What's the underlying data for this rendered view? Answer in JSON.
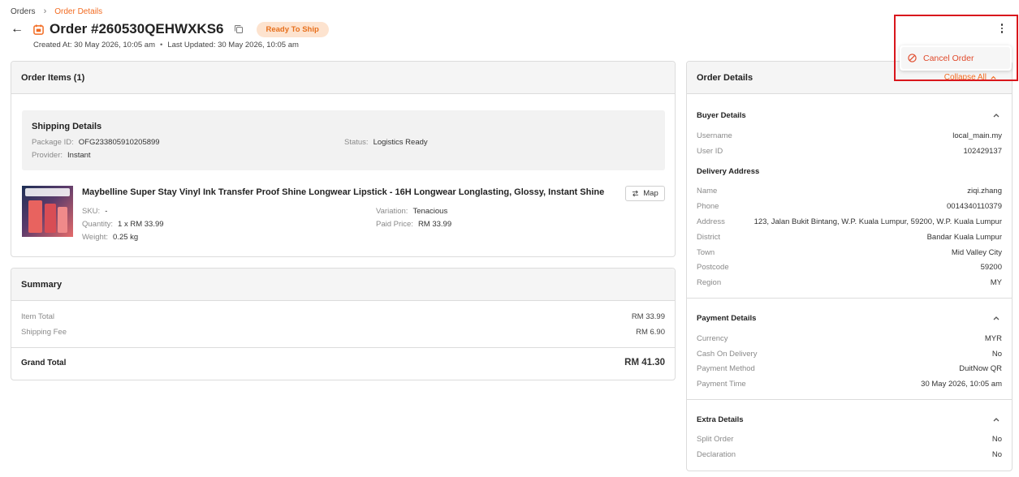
{
  "breadcrumb": {
    "root": "Orders",
    "current": "Order Details"
  },
  "header": {
    "title": "Order #260530QEHWXKS6",
    "status": "Ready To Ship",
    "created": "Created At: 30 May 2026, 10:05 am",
    "updated": "Last Updated: 30 May 2026, 10:05 am"
  },
  "menu": {
    "cancel_label": "Cancel Order"
  },
  "order_items": {
    "title": "Order Items (1)",
    "shipping": {
      "title": "Shipping Details",
      "package_id_label": "Package ID:",
      "package_id": "OFG233805910205899",
      "provider_label": "Provider:",
      "provider": "Instant",
      "status_label": "Status:",
      "status": "Logistics Ready"
    },
    "product": {
      "name": "Maybelline Super Stay Vinyl Ink Transfer Proof Shine Longwear Lipstick - 16H Longwear Longlasting, Glossy, Instant Shine",
      "map_label": "Map",
      "sku_label": "SKU:",
      "sku": "-",
      "quantity_label": "Quantity:",
      "quantity": "1 x RM 33.99",
      "weight_label": "Weight:",
      "weight": "0.25 kg",
      "variation_label": "Variation:",
      "variation": "Tenacious",
      "paid_price_label": "Paid Price:",
      "paid_price": "RM 33.99"
    }
  },
  "summary": {
    "title": "Summary",
    "item_total_label": "Item Total",
    "item_total": "RM 33.99",
    "shipping_fee_label": "Shipping Fee",
    "shipping_fee": "RM 6.90",
    "grand_total_label": "Grand Total",
    "grand_total": "RM 41.30"
  },
  "details": {
    "title": "Order Details",
    "collapse_all": "Collapse All",
    "buyer": {
      "title": "Buyer Details",
      "username_label": "Username",
      "username": "local_main.my",
      "user_id_label": "User ID",
      "user_id": "102429137"
    },
    "delivery": {
      "title": "Delivery Address",
      "name_label": "Name",
      "name": "ziqi.zhang",
      "phone_label": "Phone",
      "phone": "0014340110379",
      "address_label": "Address",
      "address": "123, Jalan Bukit Bintang, W.P. Kuala Lumpur, 59200, W.P. Kuala Lumpur",
      "district_label": "District",
      "district": "Bandar Kuala Lumpur",
      "town_label": "Town",
      "town": "Mid Valley City",
      "postcode_label": "Postcode",
      "postcode": "59200",
      "region_label": "Region",
      "region": "MY"
    },
    "payment": {
      "title": "Payment Details",
      "currency_label": "Currency",
      "currency": "MYR",
      "cod_label": "Cash On Delivery",
      "cod": "No",
      "method_label": "Payment Method",
      "method": "DuitNow QR",
      "time_label": "Payment Time",
      "time": "30 May 2026, 10:05 am"
    },
    "extra": {
      "title": "Extra Details",
      "split_label": "Split Order",
      "split": "No",
      "declaration_label": "Declaration",
      "declaration": "No"
    }
  },
  "colors": {
    "accent": "#f26b21",
    "danger": "#e0492a",
    "highlight": "#d9161c",
    "badge_bg": "#fde3cf"
  }
}
